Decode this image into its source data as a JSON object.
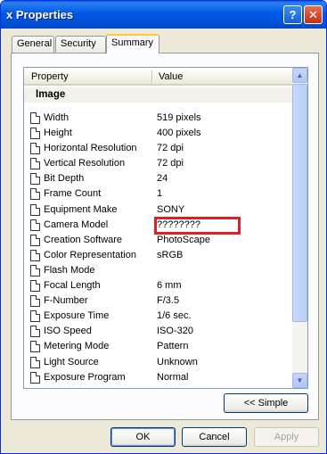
{
  "window": {
    "title": "x Properties",
    "help_glyph": "?",
    "close_glyph": "✕"
  },
  "tabs": [
    {
      "label": "General"
    },
    {
      "label": "Security"
    },
    {
      "label": "Summary"
    }
  ],
  "table": {
    "headers": {
      "property": "Property",
      "value": "Value"
    },
    "group": "Image",
    "rows": [
      {
        "name": "Width",
        "value": "519 pixels"
      },
      {
        "name": "Height",
        "value": "400 pixels"
      },
      {
        "name": "Horizontal Resolution",
        "value": "72 dpi"
      },
      {
        "name": "Vertical Resolution",
        "value": "72 dpi"
      },
      {
        "name": "Bit Depth",
        "value": "24"
      },
      {
        "name": "Frame Count",
        "value": "1"
      },
      {
        "name": "Equipment Make",
        "value": "SONY"
      },
      {
        "name": "Camera Model",
        "value": "????????"
      },
      {
        "name": "Creation Software",
        "value": "PhotoScape"
      },
      {
        "name": "Color Representation",
        "value": "sRGB"
      },
      {
        "name": "Flash Mode",
        "value": ""
      },
      {
        "name": "Focal Length",
        "value": "6 mm"
      },
      {
        "name": "F-Number",
        "value": "F/3.5"
      },
      {
        "name": "Exposure Time",
        "value": "1/6 sec."
      },
      {
        "name": "ISO Speed",
        "value": "ISO-320"
      },
      {
        "name": "Metering Mode",
        "value": "Pattern"
      },
      {
        "name": "Light Source",
        "value": "Unknown"
      },
      {
        "name": "Exposure Program",
        "value": "Normal"
      }
    ]
  },
  "buttons": {
    "simple": "<< Simple",
    "ok": "OK",
    "cancel": "Cancel",
    "apply": "Apply"
  },
  "colors": {
    "highlight": "#e11e25",
    "titlebar": "#0058e6"
  }
}
